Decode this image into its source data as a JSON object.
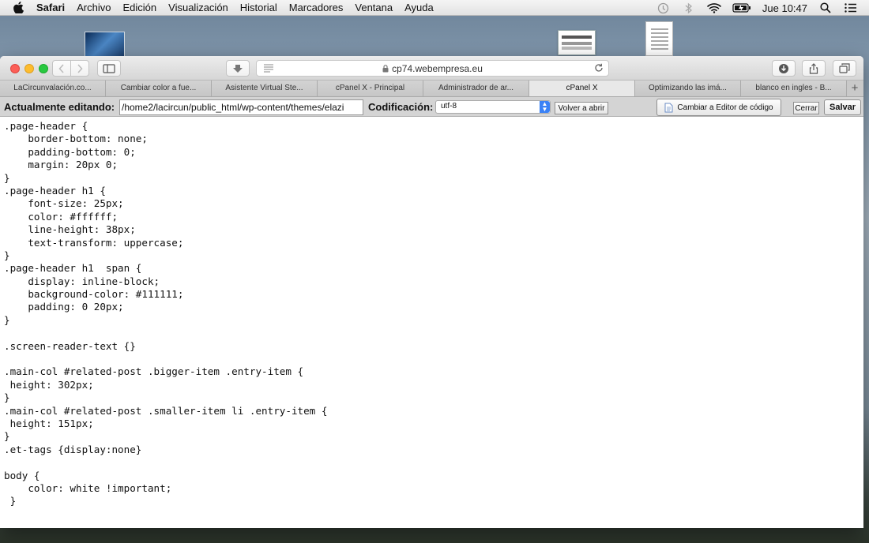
{
  "menubar": {
    "items": [
      "Safari",
      "Archivo",
      "Edición",
      "Visualización",
      "Historial",
      "Marcadores",
      "Ventana",
      "Ayuda"
    ],
    "clock": "Jue 10:47"
  },
  "browser": {
    "url": "cp74.webempresa.eu",
    "tabs": [
      {
        "label": "LaCircunvalación.co..."
      },
      {
        "label": "Cambiar color a fue..."
      },
      {
        "label": "Asistente Virtual Ste..."
      },
      {
        "label": "cPanel X - Principal"
      },
      {
        "label": "Administrador de ar..."
      },
      {
        "label": "cPanel X"
      },
      {
        "label": "Optimizando las imá..."
      },
      {
        "label": "blanco en ingles - B..."
      }
    ],
    "active_tab_index": 5,
    "new_tab": "+"
  },
  "editor": {
    "editing_label": "Actualmente editando:",
    "path_value": "/home2/lacircun/public_html/wp-content/themes/elazi",
    "encoding_label": "Codificación:",
    "encoding_value": "utf-8",
    "reopen_label": "Volver a abrir",
    "switch_label": "Cambiar a Editor de código",
    "close_label": "Cerrar",
    "save_label": "Salvar"
  },
  "code_lines": [
    ".page-header {",
    "    border-bottom: none;",
    "    padding-bottom: 0;",
    "    margin: 20px 0;",
    "}",
    ".page-header h1 {",
    "    font-size: 25px;",
    "    color: #ffffff;",
    "    line-height: 38px;",
    "    text-transform: uppercase;",
    "}",
    ".page-header h1  span {",
    "    display: inline-block;",
    "    background-color: #111111;",
    "    padding: 0 20px;",
    "}",
    "",
    ".screen-reader-text {}",
    "",
    ".main-col #related-post .bigger-item .entry-item {",
    " height: 302px;",
    "}",
    ".main-col #related-post .smaller-item li .entry-item {",
    " height: 151px;",
    "}",
    ".et-tags {display:none}",
    "",
    "body {",
    "    color: white !important;",
    " }"
  ]
}
